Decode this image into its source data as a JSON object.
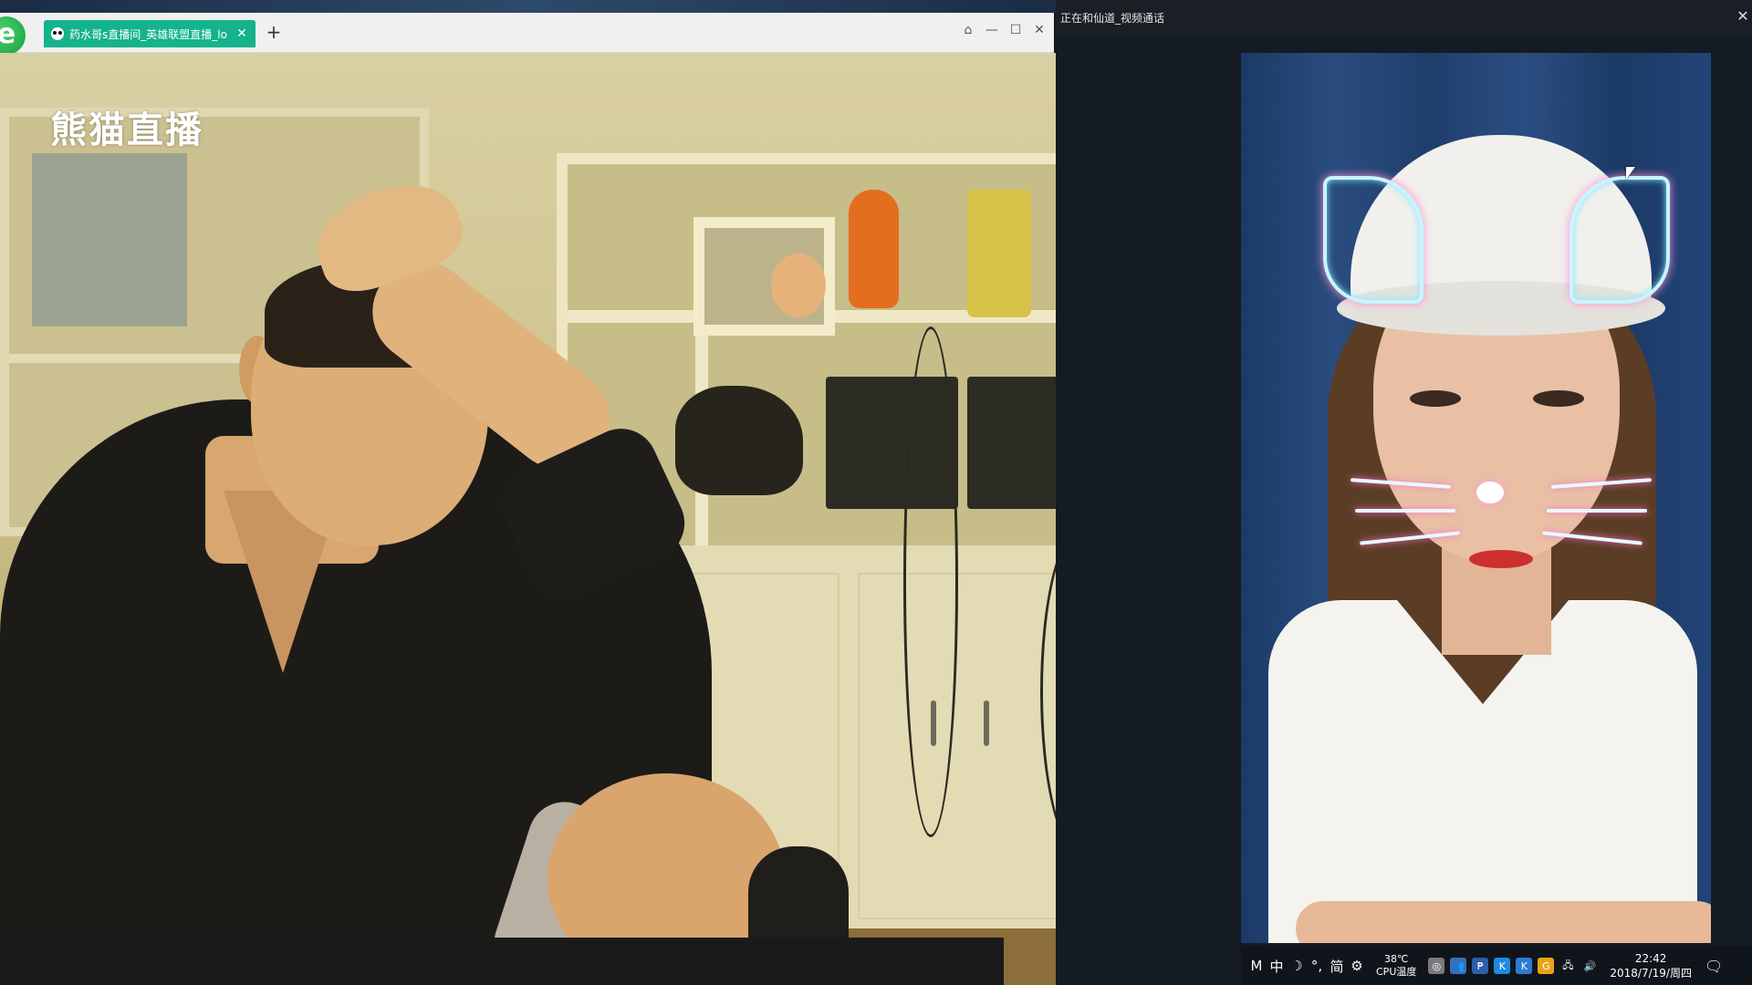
{
  "browser": {
    "logo_glyph": "e",
    "tab_title": "药水哥s直播间_英雄联盟直播_lo",
    "new_tab_glyph": "+",
    "tab_close_glyph": "✕",
    "controls": {
      "pin": "⌂",
      "minimize": "—",
      "maximize": "☐",
      "close": "✕"
    }
  },
  "stream": {
    "watermark": "熊猫直播"
  },
  "call_window": {
    "title": "正在和仙道_视频通话",
    "close_glyph": "✕"
  },
  "taskbar": {
    "tray_glyphs": [
      "M",
      "中",
      "☽",
      "°,",
      "简",
      "⚙"
    ],
    "cpu_temp": "38℃",
    "cpu_label": "CPU温度",
    "app_icons": [
      {
        "name": "shield-icon",
        "glyph": "◎",
        "color": "#7a7a7a"
      },
      {
        "name": "people-icon",
        "glyph": "👥",
        "color": "#3c6fb4"
      },
      {
        "name": "pay-icon",
        "glyph": "₱",
        "color": "#2a5fa8"
      },
      {
        "name": "k-icon",
        "glyph": "K",
        "color": "#1f8ae0"
      },
      {
        "name": "kugou-icon",
        "glyph": "K",
        "color": "#2c7bd6"
      },
      {
        "name": "g-icon",
        "glyph": "G",
        "color": "#e8a31a"
      },
      {
        "name": "network-icon",
        "glyph": "🖧",
        "color": "#444"
      },
      {
        "name": "volume-icon",
        "glyph": "🔊",
        "color": "#444"
      }
    ],
    "time": "22:42",
    "date": "2018/7/19/周四",
    "notification_glyph": "🗨"
  },
  "colors": {
    "tab_accent": "#14b38b",
    "call_bg": "#151b22",
    "taskbar_bg": "#10151c"
  }
}
